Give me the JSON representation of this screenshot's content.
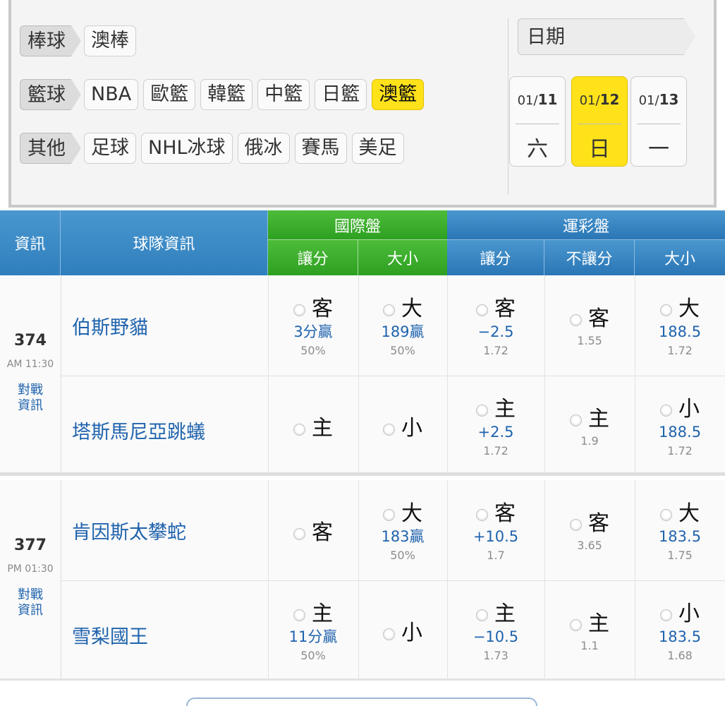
{
  "categories": [
    {
      "label": "棒球",
      "chips": [
        {
          "text": "澳棒",
          "active": false
        }
      ]
    },
    {
      "label": "籃球",
      "chips": [
        {
          "text": "NBA",
          "active": false
        },
        {
          "text": "歐籃",
          "active": false
        },
        {
          "text": "韓籃",
          "active": false
        },
        {
          "text": "中籃",
          "active": false
        },
        {
          "text": "日籃",
          "active": false
        },
        {
          "text": "澳籃",
          "active": true
        }
      ]
    },
    {
      "label": "其他",
      "chips": [
        {
          "text": "足球",
          "active": false
        },
        {
          "text": "NHL冰球",
          "active": false
        },
        {
          "text": "俄冰",
          "active": false
        },
        {
          "text": "賽馬",
          "active": false
        },
        {
          "text": "美足",
          "active": false
        }
      ]
    }
  ],
  "date_panel": {
    "label": "日期",
    "dates": [
      {
        "month": "01/",
        "day": "11",
        "weekday": "六",
        "active": false
      },
      {
        "month": "01/",
        "day": "12",
        "weekday": "日",
        "active": true
      },
      {
        "month": "01/",
        "day": "13",
        "weekday": "一",
        "active": false
      }
    ]
  },
  "table_header": {
    "info": "資訊",
    "team_info": "球隊資訊",
    "intl": "國際盤",
    "sports_lottery": "運彩盤",
    "spread": "讓分",
    "total": "大小",
    "no_spread": "不讓分"
  },
  "games": [
    {
      "number": "374",
      "time": "AM 11:30",
      "link": "對戰資訊",
      "teams": [
        {
          "name": "伯斯野貓",
          "intl_spread": {
            "pick": "客",
            "val": "3分贏",
            "sub": "50%"
          },
          "intl_total": {
            "pick": "大",
            "val": "189贏",
            "sub": "50%"
          },
          "lot_spread": {
            "pick": "客",
            "val": "−2.5",
            "sub": "1.72"
          },
          "lot_ml": {
            "pick": "客",
            "val": "",
            "sub": "1.55"
          },
          "lot_total": {
            "pick": "大",
            "val": "188.5",
            "sub": "1.72"
          }
        },
        {
          "name": "塔斯馬尼亞跳蟻",
          "intl_spread": {
            "pick": "主",
            "val": "",
            "sub": ""
          },
          "intl_total": {
            "pick": "小",
            "val": "",
            "sub": ""
          },
          "lot_spread": {
            "pick": "主",
            "val": "+2.5",
            "sub": "1.72"
          },
          "lot_ml": {
            "pick": "主",
            "val": "",
            "sub": "1.9"
          },
          "lot_total": {
            "pick": "小",
            "val": "188.5",
            "sub": "1.72"
          }
        }
      ]
    },
    {
      "number": "377",
      "time": "PM 01:30",
      "link": "對戰資訊",
      "teams": [
        {
          "name": "肯因斯太攀蛇",
          "intl_spread": {
            "pick": "客",
            "val": "",
            "sub": ""
          },
          "intl_total": {
            "pick": "大",
            "val": "183贏",
            "sub": "50%"
          },
          "lot_spread": {
            "pick": "客",
            "val": "+10.5",
            "sub": "1.7"
          },
          "lot_ml": {
            "pick": "客",
            "val": "",
            "sub": "3.65"
          },
          "lot_total": {
            "pick": "大",
            "val": "183.5",
            "sub": "1.75"
          }
        },
        {
          "name": "雪梨國王",
          "intl_spread": {
            "pick": "主",
            "val": "11分贏",
            "sub": "50%"
          },
          "intl_total": {
            "pick": "小",
            "val": "",
            "sub": ""
          },
          "lot_spread": {
            "pick": "主",
            "val": "−10.5",
            "sub": "1.73"
          },
          "lot_ml": {
            "pick": "主",
            "val": "",
            "sub": "1.1"
          },
          "lot_total": {
            "pick": "小",
            "val": "183.5",
            "sub": "1.68"
          }
        }
      ]
    }
  ]
}
